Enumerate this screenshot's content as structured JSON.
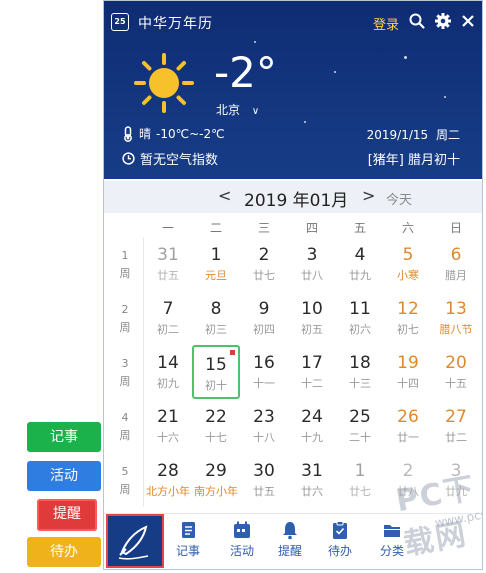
{
  "app": {
    "title": "中华万年历",
    "logo_text": "25",
    "login": "登录"
  },
  "header_icons": [
    "search-icon",
    "gear-icon",
    "close-icon"
  ],
  "weather": {
    "temp": "-2°",
    "city": "北京",
    "condition": "晴",
    "range": "-10℃~-2℃",
    "air": "暂无空气指数",
    "date": "2019/1/15",
    "weekday": "周二",
    "lunar": "[猪年] 腊月初十"
  },
  "nav": {
    "prev": "<",
    "title": "2019 年01月",
    "next": ">",
    "today": "今天"
  },
  "weekdays": [
    "一",
    "二",
    "三",
    "四",
    "五",
    "六",
    "日"
  ],
  "weeks": [
    {
      "num": "1",
      "label": "周"
    },
    {
      "num": "2",
      "label": "周"
    },
    {
      "num": "3",
      "label": "周"
    },
    {
      "num": "4",
      "label": "周"
    },
    {
      "num": "5",
      "label": "周"
    }
  ],
  "days": [
    [
      {
        "d": "31",
        "l": "廿五"
      },
      {
        "d": "1",
        "l": "元旦"
      },
      {
        "d": "2",
        "l": "廿七"
      },
      {
        "d": "3",
        "l": "廿八"
      },
      {
        "d": "4",
        "l": "廿九"
      },
      {
        "d": "5",
        "l": "小寒"
      },
      {
        "d": "6",
        "l": "腊月"
      }
    ],
    [
      {
        "d": "7",
        "l": "初二"
      },
      {
        "d": "8",
        "l": "初三"
      },
      {
        "d": "9",
        "l": "初四"
      },
      {
        "d": "10",
        "l": "初五"
      },
      {
        "d": "11",
        "l": "初六"
      },
      {
        "d": "12",
        "l": "初七"
      },
      {
        "d": "13",
        "l": "腊八节"
      }
    ],
    [
      {
        "d": "14",
        "l": "初九"
      },
      {
        "d": "15",
        "l": "初十"
      },
      {
        "d": "16",
        "l": "十一"
      },
      {
        "d": "17",
        "l": "十二"
      },
      {
        "d": "18",
        "l": "十三"
      },
      {
        "d": "19",
        "l": "十四"
      },
      {
        "d": "20",
        "l": "十五"
      }
    ],
    [
      {
        "d": "21",
        "l": "十六"
      },
      {
        "d": "22",
        "l": "十七"
      },
      {
        "d": "23",
        "l": "十八"
      },
      {
        "d": "24",
        "l": "十九"
      },
      {
        "d": "25",
        "l": "二十"
      },
      {
        "d": "26",
        "l": "廿一"
      },
      {
        "d": "27",
        "l": "廿二"
      }
    ],
    [
      {
        "d": "28",
        "l": "北方小年"
      },
      {
        "d": "29",
        "l": "南方小年"
      },
      {
        "d": "30",
        "l": "廿五"
      },
      {
        "d": "31",
        "l": "廿六"
      },
      {
        "d": "1",
        "l": "廿七"
      },
      {
        "d": "2",
        "l": "廿八"
      },
      {
        "d": "3",
        "l": "廿九"
      }
    ]
  ],
  "bottom": [
    {
      "label": "记事",
      "icon": "note-icon"
    },
    {
      "label": "活动",
      "icon": "calendar-icon"
    },
    {
      "label": "提醒",
      "icon": "bell-icon"
    },
    {
      "label": "待办",
      "icon": "clipboard-icon"
    },
    {
      "label": "分类",
      "icon": "folder-icon"
    }
  ],
  "side_buttons": [
    {
      "label": "记事",
      "color": "#1bb24b"
    },
    {
      "label": "活动",
      "color": "#2f7de1"
    },
    {
      "label": "提醒",
      "color": "#e03a3a"
    },
    {
      "label": "待办",
      "color": "#efb21a"
    }
  ],
  "watermark": {
    "main": "PC下载网",
    "sub": "www.pcsoft.com.cn"
  },
  "colors": {
    "header_bg": "#13367f",
    "accent_orange": "#e0892a",
    "today_border": "#51c06a",
    "muted_gray": "#a0a0a0"
  }
}
